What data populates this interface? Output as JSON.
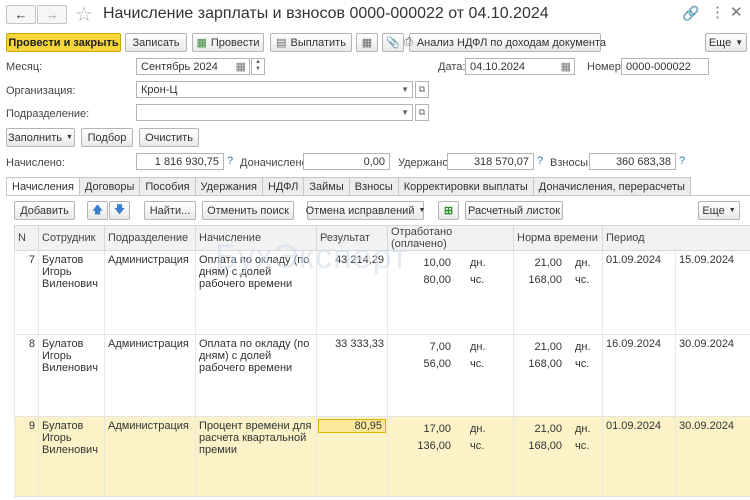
{
  "window": {
    "title": "Начисление зарплаты и взносов 0000-000022 от 04.10.2024"
  },
  "toolbar": {
    "post_close": "Провести и закрыть",
    "save": "Записать",
    "post": "Провести",
    "pay": "Выплатить",
    "ndfl_analysis": "Анализ НДФЛ по доходам документа",
    "more": "Еще"
  },
  "header": {
    "month_label": "Месяц:",
    "month_value": "Сентябрь 2024",
    "date_label": "Дата:",
    "date_value": "04.10.2024",
    "number_label": "Номер:",
    "number_value": "0000-000022",
    "org_label": "Организация:",
    "org_value": "Крон-Ц",
    "dept_label": "Подразделение:",
    "dept_value": ""
  },
  "actions": {
    "fill": "Заполнить",
    "select": "Подбор",
    "clear": "Очистить"
  },
  "totals": {
    "accrued_label": "Начислено:",
    "accrued_value": "1 816 930,75",
    "additional_label": "Доначислено:",
    "additional_value": "0,00",
    "withheld_label": "Удержано:",
    "withheld_value": "318 570,07",
    "contrib_label": "Взносы:",
    "contrib_value": "360 683,38",
    "help": "?"
  },
  "tabs": [
    "Начисления",
    "Договоры",
    "Пособия",
    "Удержания",
    "НДФЛ",
    "Займы",
    "Взносы",
    "Корректировки выплаты",
    "Доначисления, перерасчеты"
  ],
  "grid_toolbar": {
    "add": "Добавить",
    "find": "Найти...",
    "cancel_search": "Отменить поиск",
    "cancel_corrections": "Отмена исправлений",
    "payslip": "Расчетный листок",
    "more": "Еще"
  },
  "watermark": "БухЭксперт",
  "table": {
    "columns": [
      "N",
      "Сотрудник",
      "Подразделение",
      "Начисление",
      "Результат",
      "Отработано (оплачено)",
      "Норма времени",
      "Период"
    ],
    "rows": [
      {
        "n": "7",
        "employee": "Булатов Игорь Виленович",
        "dept": "Администрация",
        "accrual": "Оплата по окладу (по дням) с долей рабочего времени",
        "result": "43 214,29",
        "worked_days": "10,00",
        "worked_days_unit": "дн.",
        "worked_hours": "80,00",
        "worked_hours_unit": "чс.",
        "norm_days": "21,00",
        "norm_days_unit": "дн.",
        "norm_hours": "168,00",
        "norm_hours_unit": "чс.",
        "period_from": "01.09.2024",
        "period_to": "15.09.2024"
      },
      {
        "n": "8",
        "employee": "Булатов Игорь Виленович",
        "dept": "Администрация",
        "accrual": "Оплата по окладу (по дням) с долей рабочего времени",
        "result": "33 333,33",
        "worked_days": "7,00",
        "worked_days_unit": "дн.",
        "worked_hours": "56,00",
        "worked_hours_unit": "чс.",
        "norm_days": "21,00",
        "norm_days_unit": "дн.",
        "norm_hours": "168,00",
        "norm_hours_unit": "чс.",
        "period_from": "16.09.2024",
        "period_to": "30.09.2024"
      },
      {
        "n": "9",
        "employee": "Булатов Игорь Виленович",
        "dept": "Администрация",
        "accrual": "Процент времени для расчета квартальной премии",
        "result": "80,95",
        "worked_days": "17,00",
        "worked_days_unit": "дн.",
        "worked_hours": "136,00",
        "worked_hours_unit": "чс.",
        "norm_days": "21,00",
        "norm_days_unit": "дн.",
        "norm_hours": "168,00",
        "norm_hours_unit": "чс.",
        "period_from": "01.09.2024",
        "period_to": "30.09.2024"
      }
    ]
  }
}
